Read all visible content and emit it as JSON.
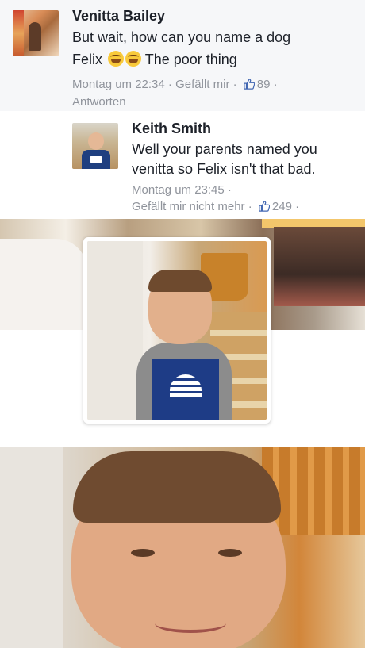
{
  "comments": [
    {
      "author": "Venitta Bailey",
      "text_line1": "But wait, how can you name a dog",
      "text_line2_before": "Felix",
      "text_line2_after": "The poor thing",
      "emojis": [
        "tears-of-joy-emoji",
        "tears-of-joy-emoji"
      ],
      "time": "Montag um 22:34",
      "like_label": "Gefällt mir",
      "like_count": "89",
      "reply_label": "Antworten",
      "separator": "·"
    },
    {
      "author": "Keith Smith",
      "text_line1": "Well your parents named you",
      "text_line2": "venitta so Felix isn't that bad.",
      "time": "Montag um 23:45",
      "like_label": "Gefällt mir nicht mehr",
      "like_count": "249",
      "separator": "·"
    }
  ],
  "icons": {
    "like": "thumbs-up-icon",
    "accent": "#4267b2"
  }
}
